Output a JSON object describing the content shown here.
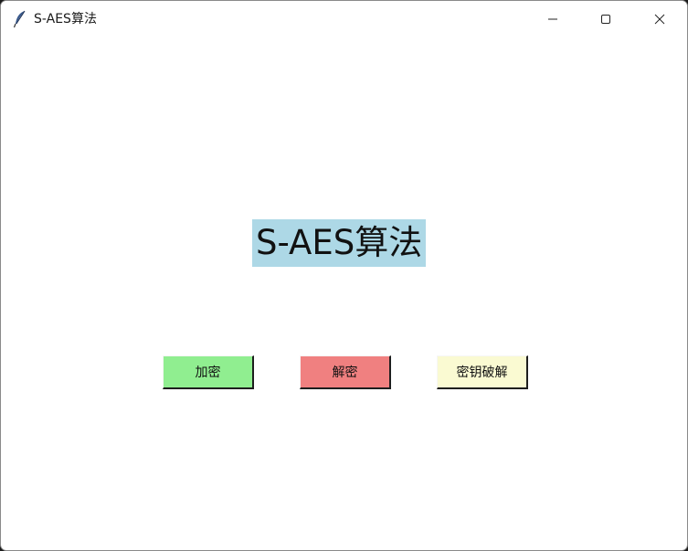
{
  "window": {
    "title": "S-AES算法",
    "controls": {
      "minimize_icon": "minimize-icon",
      "maximize_icon": "maximize-icon",
      "close_icon": "close-icon"
    }
  },
  "main": {
    "heading": "S-AES算法",
    "heading_bg": "#add8e6",
    "buttons": [
      {
        "label": "加密",
        "color": "#90ee90"
      },
      {
        "label": "解密",
        "color": "#f08080"
      },
      {
        "label": "密钥破解",
        "color": "#fafad2"
      }
    ]
  }
}
